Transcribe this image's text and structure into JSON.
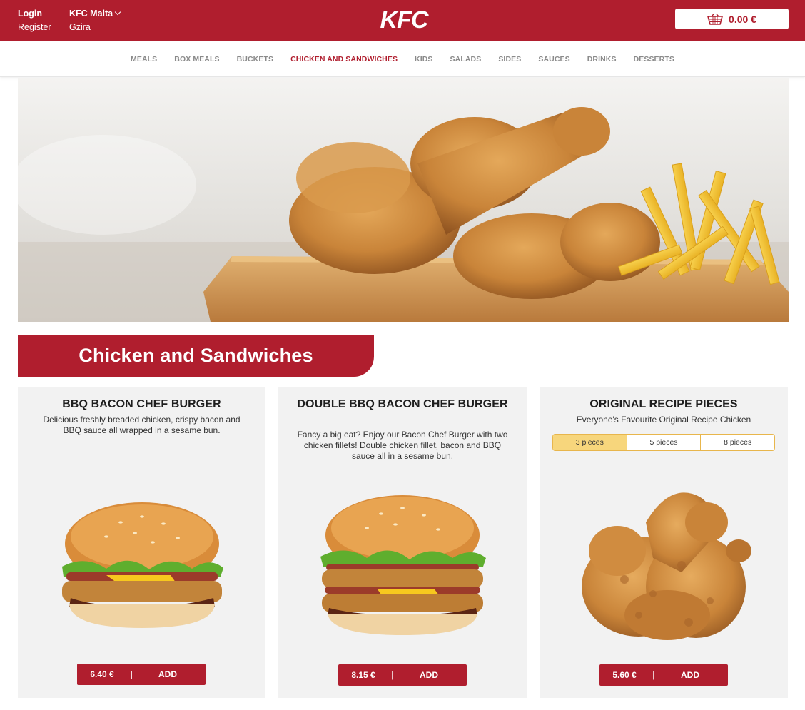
{
  "header": {
    "login_label": "Login",
    "register_label": "Register",
    "store_name": "KFC Malta",
    "store_city": "Gzira",
    "logo_text": "KFC",
    "cart_total": "0.00 €",
    "brand_color": "#b01e2e"
  },
  "nav": {
    "items": [
      {
        "label": "MEALS",
        "active": false
      },
      {
        "label": "BOX MEALS",
        "active": false
      },
      {
        "label": "BUCKETS",
        "active": false
      },
      {
        "label": "CHICKEN AND SANDWICHES",
        "active": true
      },
      {
        "label": "KIDS",
        "active": false
      },
      {
        "label": "SALADS",
        "active": false
      },
      {
        "label": "SIDES",
        "active": false
      },
      {
        "label": "SAUCES",
        "active": false
      },
      {
        "label": "DRINKS",
        "active": false
      },
      {
        "label": "DESSERTS",
        "active": false
      }
    ]
  },
  "section": {
    "title": "Chicken and Sandwiches"
  },
  "products": [
    {
      "name": "BBQ BACON CHEF BURGER",
      "description": "Delicious freshly breaded chicken, crispy bacon and BBQ sauce all wrapped in a sesame bun.",
      "price": "6.40 €",
      "separator": "|",
      "add_label": "ADD",
      "image": "burger-image"
    },
    {
      "name": "DOUBLE BBQ BACON CHEF BURGER",
      "description": "Fancy a big eat? Enjoy our Bacon Chef Burger with two chicken fillets! Double chicken fillet, bacon and BBQ sauce all in a sesame bun.",
      "price": "8.15 €",
      "separator": "|",
      "add_label": "ADD",
      "image": "double-burger-image"
    },
    {
      "name": "ORIGINAL RECIPE PIECES",
      "description": "Everyone's Favourite Original Recipe Chicken",
      "options": [
        "3 pieces",
        "5 pieces",
        "8 pieces"
      ],
      "selected_option": "3 pieces",
      "price": "5.60 €",
      "separator": "|",
      "add_label": "ADD",
      "image": "chicken-pieces-image"
    }
  ]
}
